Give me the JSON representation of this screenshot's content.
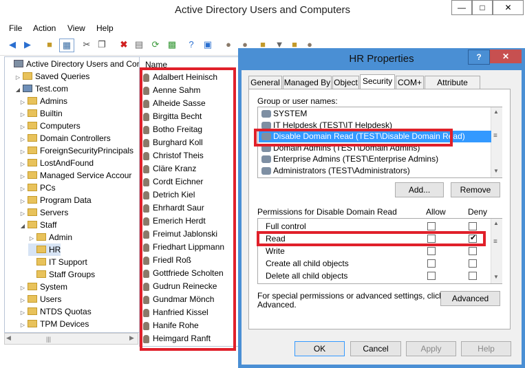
{
  "main": {
    "title": "Active Directory Users and Computers",
    "menus": [
      "File",
      "Action",
      "View",
      "Help"
    ],
    "caption_buttons": [
      "—",
      "□",
      "✕"
    ]
  },
  "tree": {
    "items": [
      {
        "label": "Active Directory Users and Com",
        "level": 0,
        "exp": ""
      },
      {
        "label": "Saved Queries",
        "level": 1,
        "exp": "▷"
      },
      {
        "label": "Test.com",
        "level": 1,
        "exp": "◢"
      },
      {
        "label": "Admins",
        "level": 2,
        "exp": "▷"
      },
      {
        "label": "Builtin",
        "level": 2,
        "exp": "▷"
      },
      {
        "label": "Computers",
        "level": 2,
        "exp": "▷"
      },
      {
        "label": "Domain Controllers",
        "level": 2,
        "exp": "▷"
      },
      {
        "label": "ForeignSecurityPrincipals",
        "level": 2,
        "exp": "▷"
      },
      {
        "label": "LostAndFound",
        "level": 2,
        "exp": "▷"
      },
      {
        "label": "Managed Service Accour",
        "level": 2,
        "exp": "▷"
      },
      {
        "label": "PCs",
        "level": 2,
        "exp": "▷"
      },
      {
        "label": "Program Data",
        "level": 2,
        "exp": "▷"
      },
      {
        "label": "Servers",
        "level": 2,
        "exp": "▷"
      },
      {
        "label": "Staff",
        "level": 2,
        "exp": "◢"
      },
      {
        "label": "Admin",
        "level": 3,
        "exp": "▷"
      },
      {
        "label": "HR",
        "level": 3,
        "exp": "",
        "selected": true
      },
      {
        "label": "IT Support",
        "level": 3,
        "exp": ""
      },
      {
        "label": "Staff Groups",
        "level": 3,
        "exp": ""
      },
      {
        "label": "System",
        "level": 2,
        "exp": "▷"
      },
      {
        "label": "Users",
        "level": 2,
        "exp": "▷"
      },
      {
        "label": "NTDS Quotas",
        "level": 2,
        "exp": "▷"
      },
      {
        "label": "TPM Devices",
        "level": 2,
        "exp": "▷"
      }
    ]
  },
  "list": {
    "header": "Name",
    "items": [
      "Adalbert Heinisch",
      "Aenne Sahm",
      "Alheide Sasse",
      "Birgitta Becht",
      "Botho Freitag",
      "Burghard Koll",
      "Christof Theis",
      "Cläre Kranz",
      "Cordt Eichner",
      "Detrich Kiel",
      "Ehrhardt Saur",
      "Emerich Herdt",
      "Freimut Jablonski",
      "Friedhart Lippmann",
      "Friedl Roß",
      "Gottfriede Scholten",
      "Gudrun Reinecke",
      "Gundmar Mönch",
      "Hanfried Kissel",
      "Hanife Rohe",
      "Heimgard Ranft"
    ]
  },
  "dialog": {
    "title": "HR Properties",
    "help_btn": "?",
    "close_btn": "✕",
    "tabs": [
      "General",
      "Managed By",
      "Object",
      "Security",
      "COM+",
      "Attribute Editor"
    ],
    "active_tab": "Security",
    "group_label": "Group or user names:",
    "groups": [
      "SYSTEM",
      "IT Helpdesk (TEST\\IT Helpdesk)",
      "Disable Domain Read (TEST\\Disable Domain Read)",
      "Domain Admins (TEST\\Domain Admins)",
      "Enterprise Admins (TEST\\Enterprise Admins)",
      "Administrators (TEST\\Administrators)"
    ],
    "selected_group": 2,
    "add_btn": "Add...",
    "remove_btn": "Remove",
    "perm_label": "Permissions for Disable Domain Read",
    "allow_label": "Allow",
    "deny_label": "Deny",
    "permissions": [
      {
        "name": "Full control",
        "allow": false,
        "deny": false
      },
      {
        "name": "Read",
        "allow": false,
        "deny": true
      },
      {
        "name": "Write",
        "allow": false,
        "deny": false
      },
      {
        "name": "Create all child objects",
        "allow": false,
        "deny": false
      },
      {
        "name": "Delete all child objects",
        "allow": false,
        "deny": false
      }
    ],
    "special_text_1": "For special permissions or advanced settings, click",
    "special_text_2": "Advanced.",
    "advanced_btn": "Advanced",
    "ok_btn": "OK",
    "cancel_btn": "Cancel",
    "apply_btn": "Apply",
    "help_text_btn": "Help"
  },
  "colors": {
    "highlight_box": "#e0202a",
    "selection": "#3399ff",
    "dialog_frame": "#4a8fd4"
  }
}
